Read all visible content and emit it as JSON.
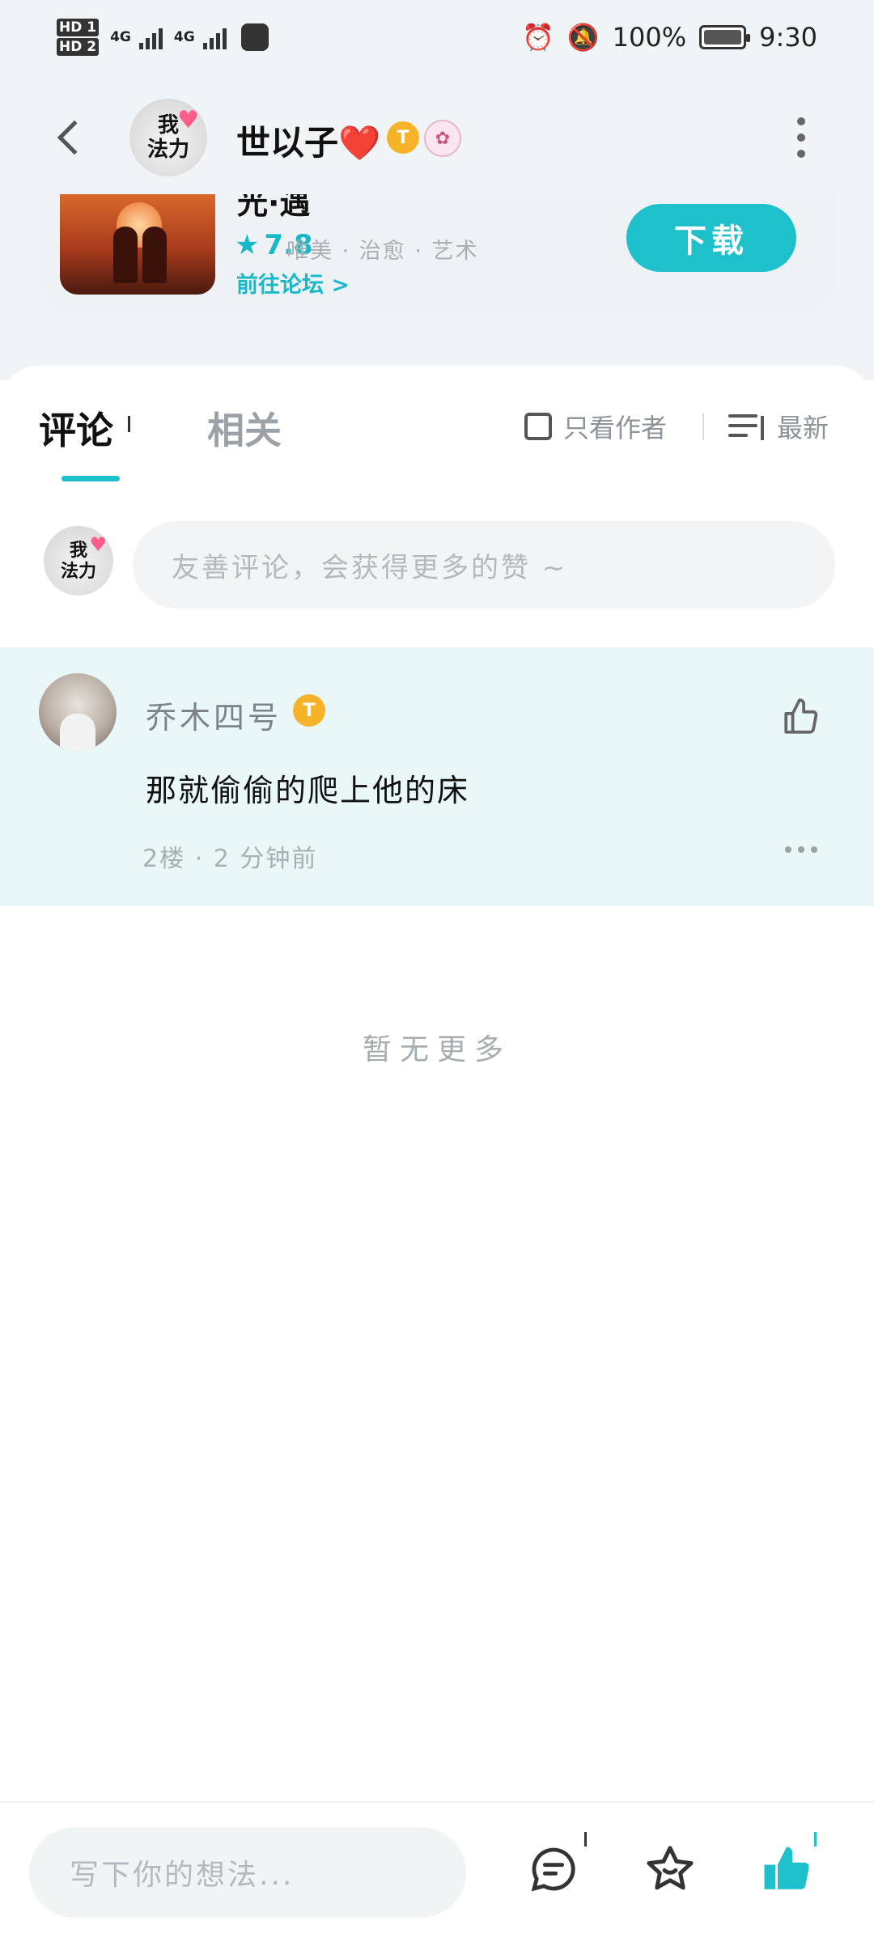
{
  "status_bar": {
    "hd1": "HD 1",
    "hd2": "HD 2",
    "net1": "4G",
    "net2": "4G",
    "battery": "100%",
    "time": "9:30"
  },
  "header": {
    "title": "世以子❤️",
    "avatar_text": "我\n法力",
    "badge": "T"
  },
  "game_card": {
    "name": "光·遇",
    "rating": "7.8",
    "tags": "唯美 · 治愈 · 艺术",
    "forum_link": "前往论坛 >",
    "download_label": "下载"
  },
  "tabs": {
    "comments": "评论",
    "related": "相关"
  },
  "filters": {
    "author_only": "只看作者",
    "sort": "最新"
  },
  "comment_input": {
    "placeholder": "友善评论，会获得更多的赞 ~"
  },
  "comments": [
    {
      "name": "乔木四号",
      "badge": "T",
      "text": "那就偷偷的爬上他的床",
      "meta": "2楼 · 2 分钟前"
    }
  ],
  "no_more": "暂无更多",
  "bottom_bar": {
    "write_placeholder": "写下你的想法..."
  },
  "colors": {
    "accent": "#1ec0cc",
    "gold_badge": "#f6b32a",
    "highlight_bg": "#e9f7f8"
  }
}
